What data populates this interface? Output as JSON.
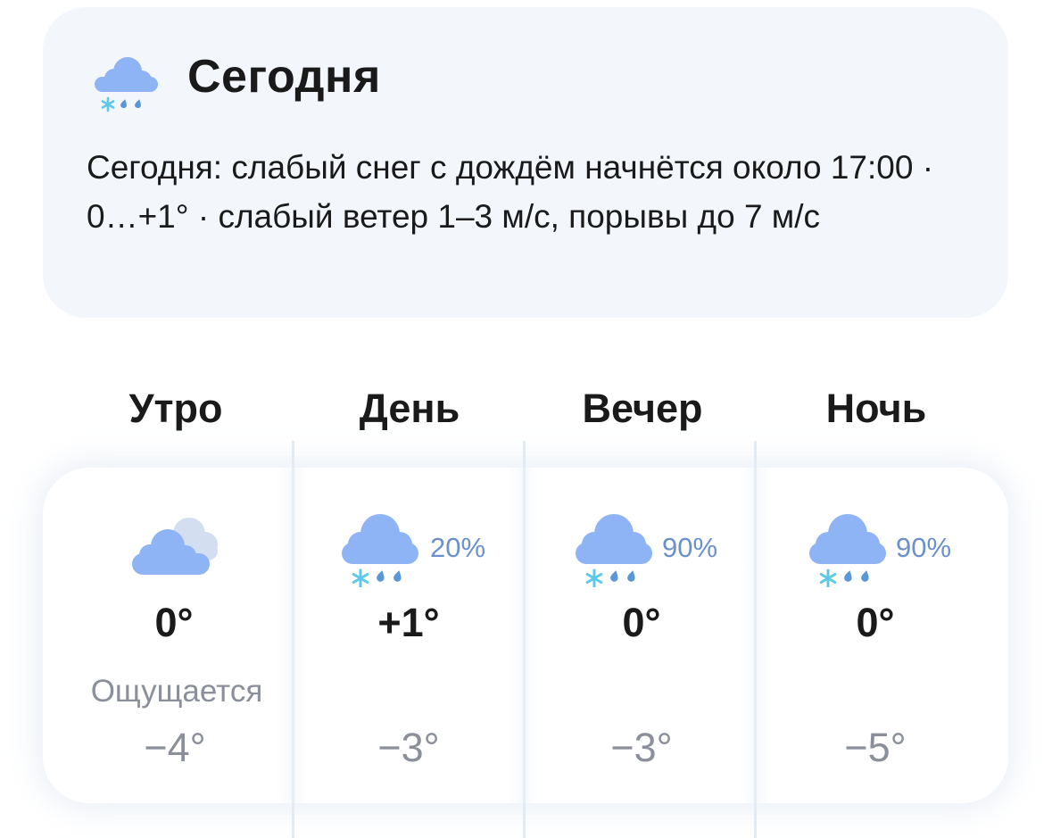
{
  "today": {
    "title": "Сегодня",
    "description": "Сегодня: слабый снег с дождём начнётся около 17:00 · 0…+1° · слабый ветер 1–3 м/с, порывы до 7 м/с",
    "icon": "cloud-snow-rain-icon"
  },
  "feels_like_label": "Ощущается",
  "periods": [
    {
      "name": "Утро",
      "icon": "cloudy-icon",
      "precip": "",
      "temp": "0°",
      "feels": "−4°"
    },
    {
      "name": "День",
      "icon": "cloud-snow-rain-icon",
      "precip": "20%",
      "temp": "+1°",
      "feels": "−3°"
    },
    {
      "name": "Вечер",
      "icon": "cloud-snow-rain-icon",
      "precip": "90%",
      "temp": "0°",
      "feels": "−3°"
    },
    {
      "name": "Ночь",
      "icon": "cloud-snow-rain-icon",
      "precip": "90%",
      "temp": "0°",
      "feels": "−5°"
    }
  ],
  "colors": {
    "card_background": "#f3f7fc",
    "cloud": "#8fb4f5",
    "snowflake": "#5ec8e8",
    "raindrop": "#5a97d6",
    "precip_text": "#6b90cc",
    "secondary_text": "#8a8f99"
  }
}
